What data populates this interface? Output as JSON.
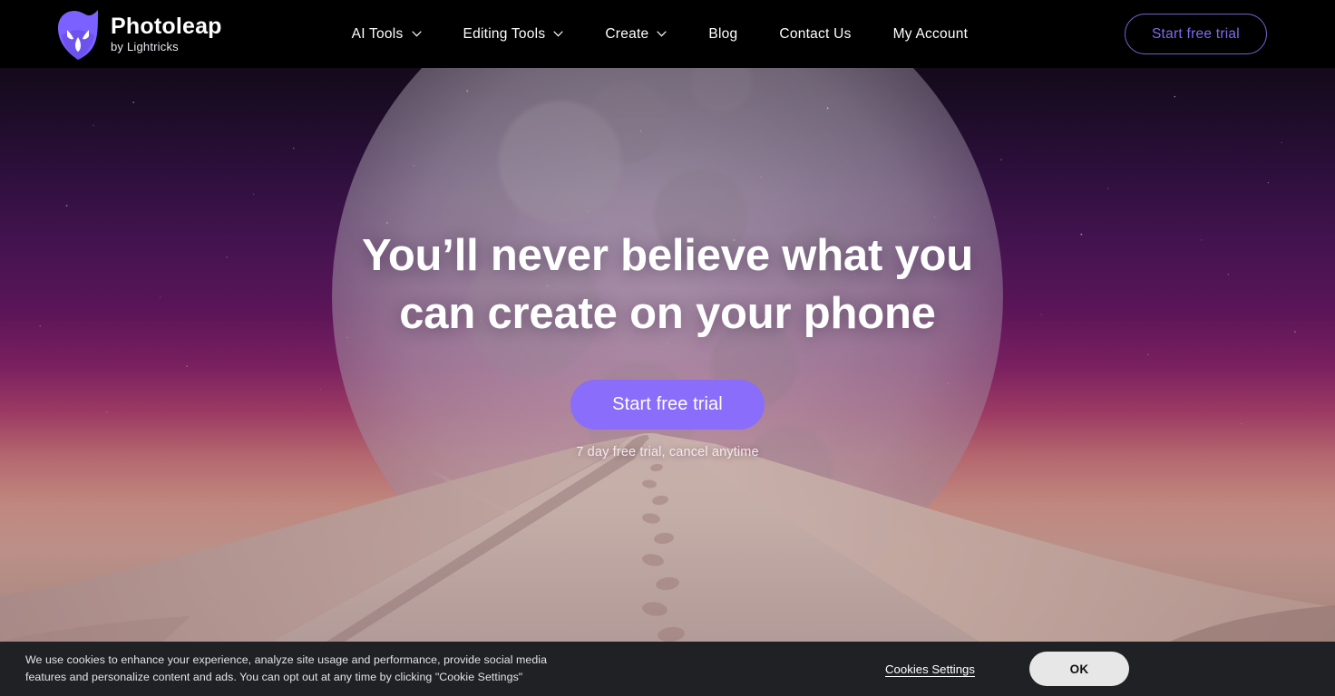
{
  "brand": {
    "name": "Photoleap",
    "tagline": "by Lightricks",
    "logo_icon": "photoleap-fox-logo-icon",
    "logo_color": "#7b61ff"
  },
  "header": {
    "background": "#000000",
    "nav_items": [
      {
        "label": "AI Tools",
        "has_dropdown": true,
        "icon": "chevron-down-icon"
      },
      {
        "label": "Editing Tools",
        "has_dropdown": true,
        "icon": "chevron-down-icon"
      },
      {
        "label": "Create",
        "has_dropdown": true,
        "icon": "chevron-down-icon"
      },
      {
        "label": "Blog",
        "has_dropdown": false
      },
      {
        "label": "Contact Us",
        "has_dropdown": false
      },
      {
        "label": "My Account",
        "has_dropdown": false
      }
    ],
    "trial_button": {
      "label": "Start free trial",
      "text_color": "#7d6bf0",
      "border_color": "#6f61c9"
    }
  },
  "hero": {
    "headline": "You’ll never believe what you can create on your phone",
    "cta_label": "Start free trial",
    "cta_color": "#8a6dfa",
    "note": "7 day free trial, cancel anytime",
    "background_description": "night sky with large moon over sand dune",
    "elements": {
      "moon": "moon-graphic",
      "stars": "starfield",
      "streak": "shooting-star-streak",
      "dune": "sand-dune",
      "figure": "walking-person-silhouette"
    }
  },
  "cookie_banner": {
    "background": "#202124",
    "message": "We use cookies to enhance your experience, analyze site usage and performance, provide social media features and personalize content and ads. You can opt out at any time by clicking \"Cookie Settings\"",
    "settings_label": "Cookies Settings",
    "ok_label": "OK"
  }
}
